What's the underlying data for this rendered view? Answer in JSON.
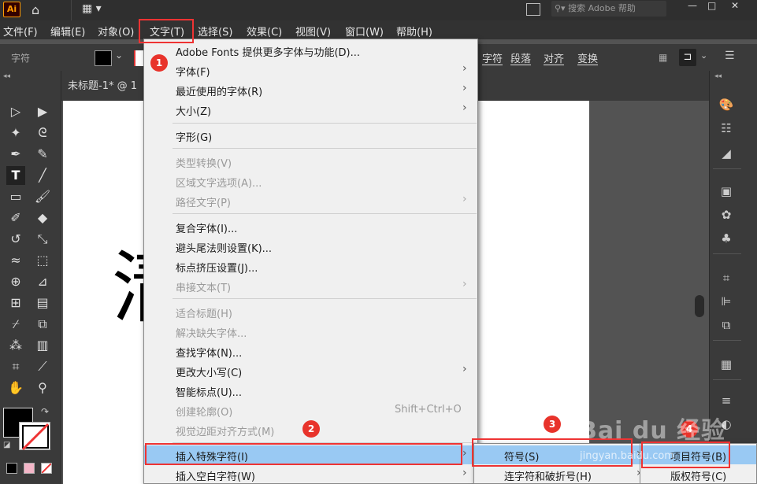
{
  "titlebar": {
    "logo": "Ai",
    "search_placeholder": "搜索 Adobe 帮助",
    "win_min": "—",
    "win_max": "□",
    "win_close": "✕"
  },
  "menubar": {
    "items": [
      "文件(F)",
      "编辑(E)",
      "对象(O)",
      "文字(T)",
      "选择(S)",
      "效果(C)",
      "视图(V)",
      "窗口(W)",
      "帮助(H)"
    ]
  },
  "controlbar": {
    "label": "字符",
    "right_items": [
      "字符",
      "段落",
      "对齐",
      "变换"
    ]
  },
  "document": {
    "tab_title": "未标题-1* @ 1",
    "big_char": "清"
  },
  "text_menu": {
    "items": [
      {
        "label": "Adobe Fonts 提供更多字体与功能(D)...",
        "shortcut": "",
        "submenu": false,
        "disabled": false
      },
      {
        "label": "字体(F)",
        "shortcut": "",
        "submenu": true,
        "disabled": false
      },
      {
        "label": "最近使用的字体(R)",
        "shortcut": "",
        "submenu": true,
        "disabled": false
      },
      {
        "label": "大小(Z)",
        "shortcut": "",
        "submenu": true,
        "disabled": false
      },
      {
        "label": "字形(G)",
        "shortcut": "",
        "submenu": false,
        "disabled": false
      },
      {
        "label": "类型转换(V)",
        "shortcut": "",
        "submenu": false,
        "disabled": true
      },
      {
        "label": "区域文字选项(A)...",
        "shortcut": "",
        "submenu": false,
        "disabled": true
      },
      {
        "label": "路径文字(P)",
        "shortcut": "",
        "submenu": true,
        "disabled": true
      },
      {
        "label": "复合字体(I)...",
        "shortcut": "",
        "submenu": false,
        "disabled": false
      },
      {
        "label": "避头尾法则设置(K)...",
        "shortcut": "",
        "submenu": false,
        "disabled": false
      },
      {
        "label": "标点挤压设置(J)...",
        "shortcut": "",
        "submenu": false,
        "disabled": false
      },
      {
        "label": "串接文本(T)",
        "shortcut": "",
        "submenu": true,
        "disabled": true
      },
      {
        "label": "适合标题(H)",
        "shortcut": "",
        "submenu": false,
        "disabled": true
      },
      {
        "label": "解决缺失字体...",
        "shortcut": "",
        "submenu": false,
        "disabled": true
      },
      {
        "label": "查找字体(N)...",
        "shortcut": "",
        "submenu": false,
        "disabled": false
      },
      {
        "label": "更改大小写(C)",
        "shortcut": "",
        "submenu": true,
        "disabled": false
      },
      {
        "label": "智能标点(U)...",
        "shortcut": "",
        "submenu": false,
        "disabled": false
      },
      {
        "label": "创建轮廓(O)",
        "shortcut": "Shift+Ctrl+O",
        "submenu": false,
        "disabled": true
      },
      {
        "label": "视觉边距对齐方式(M)",
        "shortcut": "",
        "submenu": false,
        "disabled": true
      },
      {
        "label": "插入特殊字符(I)",
        "shortcut": "",
        "submenu": true,
        "disabled": false
      },
      {
        "label": "插入空白字符(W)",
        "shortcut": "",
        "submenu": true,
        "disabled": false
      }
    ]
  },
  "special_submenu": {
    "items": [
      {
        "label": "符号(S)",
        "submenu": true
      },
      {
        "label": "连字符和破折号(H)",
        "submenu": true
      }
    ]
  },
  "symbol_submenu": {
    "items": [
      "项目符号(B)",
      "版权符号(C)"
    ]
  },
  "markers": [
    "1",
    "2",
    "3",
    "4"
  ],
  "watermark": {
    "logo": "Bai du 经验",
    "url": "jingyan.baidu.com"
  },
  "colors": {
    "highlight": "#99c9f3",
    "annotation_red": "#e8332b"
  }
}
